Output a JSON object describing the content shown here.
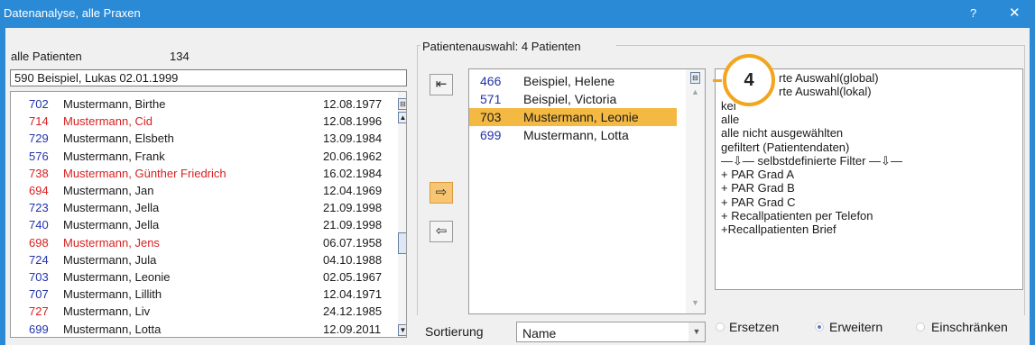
{
  "window": {
    "title": "Datenanalyse, alle Praxen",
    "help": "?",
    "close": "✕"
  },
  "left": {
    "label": "alle Patienten",
    "count": "134",
    "search_value": "590 Beispiel, Lukas  02.01.1999",
    "rows": [
      {
        "num": "702",
        "name": "Mustermann, Birthe",
        "date": "12.08.1977",
        "color": "blue"
      },
      {
        "num": "714",
        "name": "Mustermann, Cid",
        "date": "12.08.1996",
        "color": "red"
      },
      {
        "num": "729",
        "name": "Mustermann, Elsbeth",
        "date": "13.09.1984",
        "color": "blue"
      },
      {
        "num": "576",
        "name": "Mustermann, Frank",
        "date": "20.06.1962",
        "color": "blue"
      },
      {
        "num": "738",
        "name": "Mustermann, Günther Friedrich",
        "date": "16.02.1984",
        "color": "red"
      },
      {
        "num": "694",
        "name": "Mustermann, Jan",
        "date": "12.04.1969",
        "color": "rednum"
      },
      {
        "num": "723",
        "name": "Mustermann, Jella",
        "date": "21.09.1998",
        "color": "blue"
      },
      {
        "num": "740",
        "name": "Mustermann, Jella",
        "date": "21.09.1998",
        "color": "blue"
      },
      {
        "num": "698",
        "name": "Mustermann, Jens",
        "date": "06.07.1958",
        "color": "red"
      },
      {
        "num": "724",
        "name": "Mustermann, Jula",
        "date": "04.10.1988",
        "color": "blue"
      },
      {
        "num": "703",
        "name": "Mustermann, Leonie",
        "date": "02.05.1967",
        "color": "blue"
      },
      {
        "num": "707",
        "name": "Mustermann, Lillith",
        "date": "12.04.1971",
        "color": "blue"
      },
      {
        "num": "727",
        "name": "Mustermann, Liv",
        "date": "24.12.1985",
        "color": "rednum"
      },
      {
        "num": "699",
        "name": "Mustermann, Lotta",
        "date": "12.09.2011",
        "color": "blue"
      }
    ]
  },
  "selection": {
    "group_label": "Patientenauswahl:  4 Patienten",
    "rows": [
      {
        "num": "466",
        "name": "Beispiel, Helene",
        "selected": false
      },
      {
        "num": "571",
        "name": "Beispiel, Victoria",
        "selected": false
      },
      {
        "num": "703",
        "name": "Mustermann, Leonie",
        "selected": true
      },
      {
        "num": "699",
        "name": "Mustermann, Lotta",
        "selected": false
      }
    ]
  },
  "buttons": {
    "move_all_left": "⇤",
    "add": "⇨",
    "remove": "⇦"
  },
  "filter_options": [
    "gespeicherte Auswahl(global)",
    "gespeicherte Auswahl(lokal)",
    "keine",
    "alle",
    "alle nicht ausgewählten",
    "gefiltert (Patientendaten)",
    "—⇩— selbstdefinierte Filter —⇩—",
    "+ PAR Grad A",
    "+ PAR Grad B",
    "+ PAR Grad C",
    "+ Recallpatienten per Telefon",
    "+Recallpatienten Brief"
  ],
  "filter_visible": [
    "rte Auswahl(global)",
    "rte Auswahl(lokal)",
    "kei",
    "alle",
    "alle nicht ausgewählten",
    "gefiltert (Patientendaten)",
    "—⇩— selbstdefinierte Filter —⇩—",
    "+ PAR Grad A",
    "+ PAR Grad B",
    "+ PAR Grad C",
    "+ Recallpatienten per Telefon",
    "+Recallpatienten Brief"
  ],
  "sort": {
    "label": "Sortierung",
    "value": "Name"
  },
  "mode": {
    "replace": "Ersetzen",
    "extend": "Erweitern",
    "restrict": "Einschränken",
    "selected": "extend"
  },
  "callout": {
    "number": "4",
    "color": "#f2a51d"
  },
  "colors": {
    "titlebar": "#2b8ad6",
    "selection": "#f4b942",
    "blue_text": "#2233aa",
    "red_text": "#d82020"
  }
}
